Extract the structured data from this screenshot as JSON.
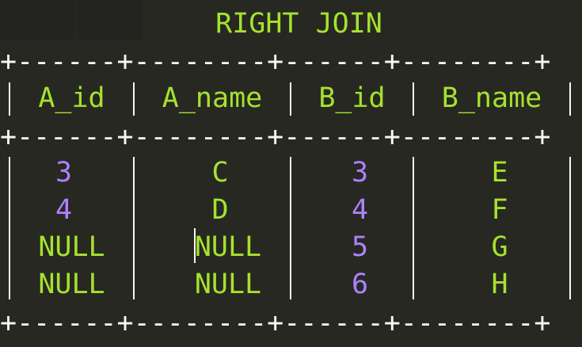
{
  "title": "RIGHT JOIN",
  "table": {
    "border_text": "+------+--------+------+--------+",
    "border_char_plus": "+",
    "border_segments": [
      "------",
      "--------",
      "------",
      "--------"
    ],
    "headers": [
      "A_id",
      "A_name",
      "B_id",
      "B_name"
    ],
    "rows": [
      [
        "3",
        "C",
        "3",
        "E"
      ],
      [
        "4",
        "D",
        "4",
        "F"
      ],
      [
        "NULL",
        "NULL",
        "5",
        "G"
      ],
      [
        "NULL",
        "NULL",
        "6",
        "H"
      ]
    ]
  },
  "colors": {
    "background": "#272822",
    "border": "#f8f8f2",
    "keyword_green": "#a6e22e",
    "number_purple": "#ae81ff"
  }
}
